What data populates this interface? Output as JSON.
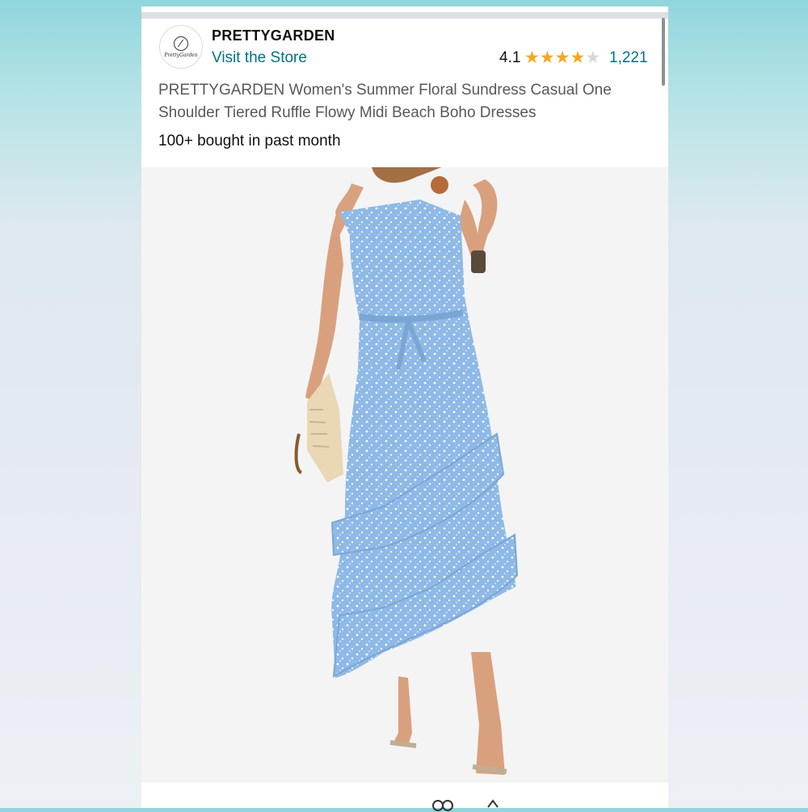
{
  "store": {
    "brand": "PRETTYGARDEN",
    "logo_text": "PrettyGarden",
    "visit_label": "Visit the Store"
  },
  "rating": {
    "value": "4.1",
    "stars_filled": 4,
    "stars_total": 5,
    "review_count": "1,221"
  },
  "product": {
    "title": "PRETTYGARDEN Women's Summer Floral Sundress Casual One Shoulder Tiered Ruffle Flowy Midi Beach Boho Dresses",
    "bought_text": "100+ bought in past month"
  },
  "colors": {
    "link": "#007185",
    "star": "#f5a623",
    "dress": "#8fb9e6"
  },
  "icons": [
    "share-icon",
    "more-icon"
  ]
}
